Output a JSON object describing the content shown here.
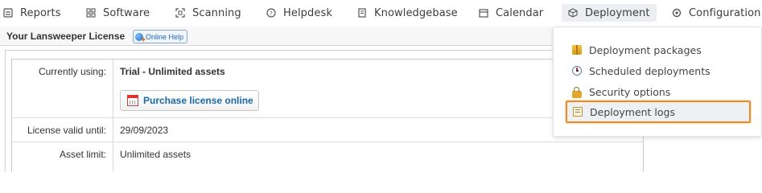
{
  "nav": {
    "items": [
      {
        "label": "Reports",
        "icon": "reports-icon"
      },
      {
        "label": "Software",
        "icon": "software-grid-icon"
      },
      {
        "label": "Scanning",
        "icon": "scanning-icon"
      },
      {
        "label": "Helpdesk",
        "icon": "helpdesk-icon"
      },
      {
        "label": "Knowledgebase",
        "icon": "knowledgebase-icon"
      },
      {
        "label": "Calendar",
        "icon": "calendar-icon"
      },
      {
        "label": "Deployment",
        "icon": "deployment-box-icon"
      },
      {
        "label": "Configuration",
        "icon": "configuration-icon"
      }
    ]
  },
  "license": {
    "title": "Your Lansweeper License",
    "help_label": "Online Help",
    "rows": {
      "currently_using": {
        "label": "Currently using:",
        "value": "Trial - Unlimited assets"
      },
      "valid_until": {
        "label": "License valid until:",
        "value": "29/09/2023"
      },
      "asset_limit": {
        "label": "Asset limit:",
        "value": "Unlimited assets"
      }
    },
    "purchase_button": "Purchase license online"
  },
  "deployment_menu": {
    "items": [
      {
        "label": "Deployment packages",
        "icon": "package-icon"
      },
      {
        "label": "Scheduled deployments",
        "icon": "clock-icon"
      },
      {
        "label": "Security options",
        "icon": "lock-icon"
      },
      {
        "label": "Deployment logs",
        "icon": "log-icon"
      }
    ],
    "highlighted_item": "Deployment logs",
    "highlight_color": "#f08a1c"
  }
}
